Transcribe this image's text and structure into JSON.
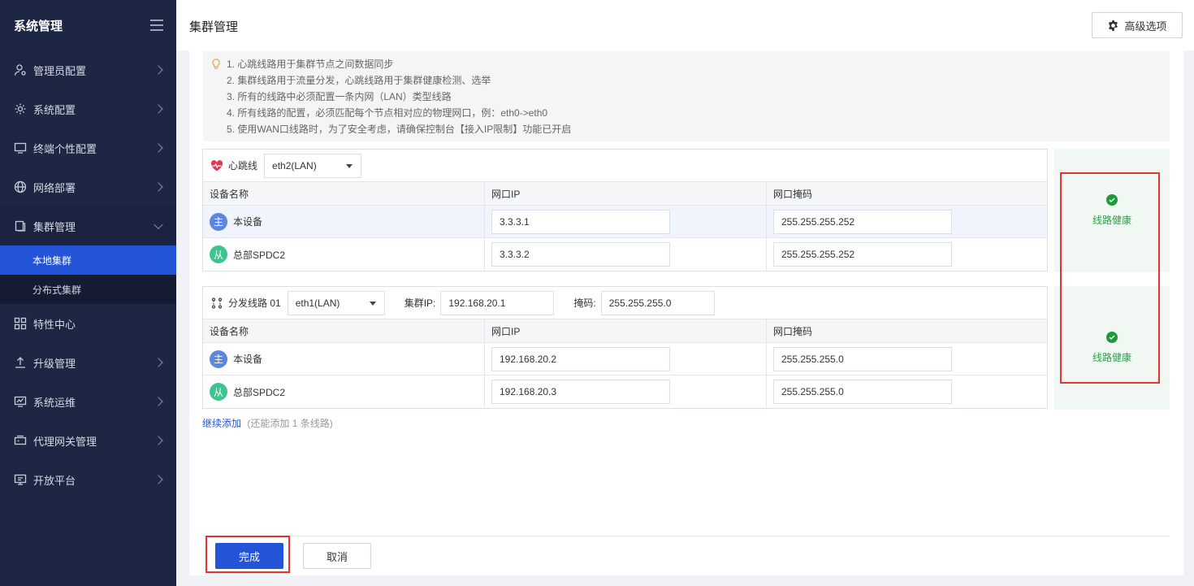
{
  "sidebar": {
    "title": "系统管理",
    "items": [
      {
        "label": "管理员配置",
        "icon": "user-admin-icon"
      },
      {
        "label": "系统配置",
        "icon": "gear-icon"
      },
      {
        "label": "终端个性配置",
        "icon": "monitor-icon"
      },
      {
        "label": "网络部署",
        "icon": "globe-icon"
      },
      {
        "label": "集群管理",
        "icon": "cluster-icon"
      },
      {
        "label": "特性中心",
        "icon": "grid-icon"
      },
      {
        "label": "升级管理",
        "icon": "upload-icon"
      },
      {
        "label": "系统运维",
        "icon": "chart-monitor-icon"
      },
      {
        "label": "代理网关管理",
        "icon": "gateway-icon"
      },
      {
        "label": "开放平台",
        "icon": "platform-icon"
      }
    ],
    "sub_items": [
      {
        "label": "本地集群",
        "active": true
      },
      {
        "label": "分布式集群",
        "active": false
      }
    ]
  },
  "header": {
    "title": "集群管理",
    "advanced_button": "高级选项"
  },
  "tips": [
    "1. 心跳线路用于集群节点之间数据同步",
    "2. 集群线路用于流量分发，心跳线路用于集群健康检测、选举",
    "3. 所有的线路中必须配置一条内网（LAN）类型线路",
    "4. 所有线路的配置，必须匹配每个节点相对应的物理网口，例：eth0->eth0",
    "5. 使用WAN口线路时，为了安全考虑，请确保控制台【接入IP限制】功能已开启"
  ],
  "columns": [
    "设备名称",
    "网口IP",
    "网口掩码"
  ],
  "heartbeat": {
    "label": "心跳线",
    "interface": "eth2(LAN)",
    "rows": [
      {
        "badge": "主",
        "name": "本设备",
        "ip": "3.3.3.1",
        "mask": "255.255.255.252"
      },
      {
        "badge": "从",
        "name": "总部SPDC2",
        "ip": "3.3.3.2",
        "mask": "255.255.255.252"
      }
    ],
    "health": "线路健康"
  },
  "distribution": {
    "label": "分发线路 01",
    "interface": "eth1(LAN)",
    "cluster_ip_label": "集群IP:",
    "cluster_ip": "192.168.20.1",
    "mask_label": "掩码:",
    "mask": "255.255.255.0",
    "rows": [
      {
        "badge": "主",
        "name": "本设备",
        "ip": "192.168.20.2",
        "mask": "255.255.255.0"
      },
      {
        "badge": "从",
        "name": "总部SPDC2",
        "ip": "192.168.20.3",
        "mask": "255.255.255.0"
      }
    ],
    "health": "线路健康"
  },
  "add_more": {
    "link": "继续添加",
    "hint": "(还能添加 1 条线路)"
  },
  "footer": {
    "done": "完成",
    "cancel": "取消"
  },
  "colors": {
    "sidebar_bg": "#1d2744",
    "accent": "#2354d8",
    "health_green": "#2aa148",
    "highlight_red": "#e3342f"
  }
}
